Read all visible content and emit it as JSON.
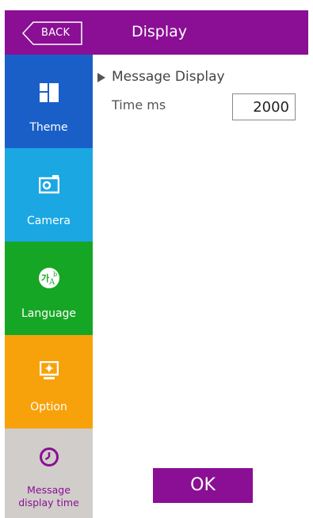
{
  "header": {
    "back_label": "BACK",
    "title": "Display"
  },
  "sidebar": {
    "items": [
      {
        "label": "Theme",
        "icon": "theme-icon",
        "color": "#1a5fc7"
      },
      {
        "label": "Camera",
        "icon": "camera-icon",
        "color": "#1aa7e2"
      },
      {
        "label": "Language",
        "icon": "language-icon",
        "color": "#16a625"
      },
      {
        "label": "Option",
        "icon": "option-icon",
        "color": "#f7a20a"
      },
      {
        "label_line1": "Message",
        "label_line2": "display time",
        "icon": "clock-icon",
        "color": "#d0cdca",
        "selected": true
      }
    ]
  },
  "main": {
    "section_title": "Message Display",
    "field_label": "Time ms",
    "field_value": "2000"
  },
  "footer": {
    "ok_label": "OK"
  },
  "colors": {
    "accent": "#8a0f94"
  }
}
